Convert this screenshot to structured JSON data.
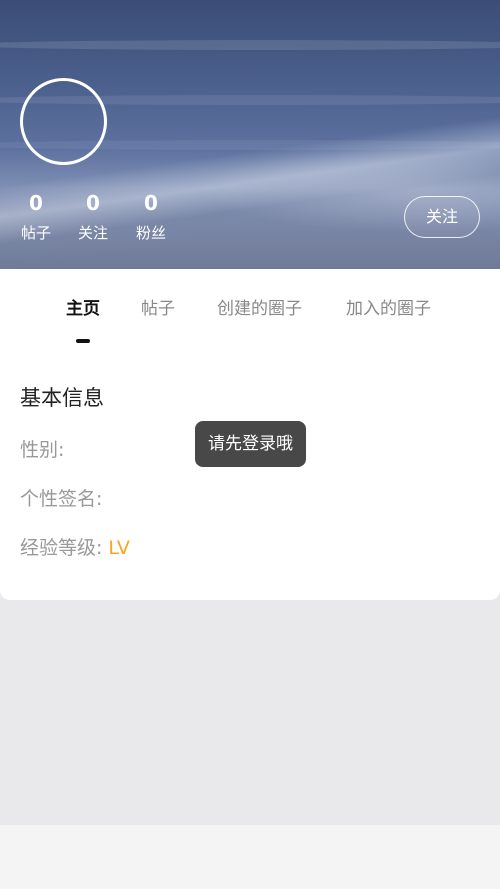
{
  "profile": {
    "stats": [
      {
        "value": "0",
        "label": "帖子"
      },
      {
        "value": "0",
        "label": "关注"
      },
      {
        "value": "0",
        "label": "粉丝"
      }
    ],
    "follow_label": "关注"
  },
  "tabs": [
    {
      "label": "主页",
      "active": true
    },
    {
      "label": "帖子",
      "active": false
    },
    {
      "label": "创建的圈子",
      "active": false
    },
    {
      "label": "加入的圈子",
      "active": false
    }
  ],
  "basic_info": {
    "title": "基本信息",
    "gender_label": "性别:",
    "signature_label": "个性签名:",
    "level_label": "经验等级:",
    "level_value": "LV"
  },
  "toast": {
    "message": "请先登录哦"
  },
  "colors": {
    "accent": "#f5a623",
    "toast_bg": "#282828"
  }
}
